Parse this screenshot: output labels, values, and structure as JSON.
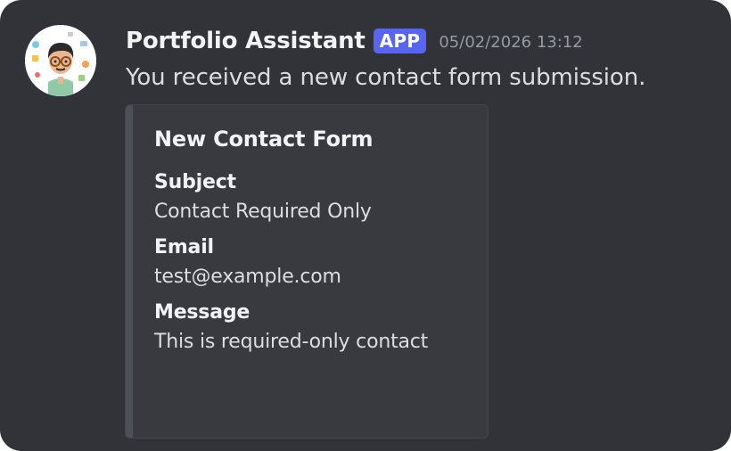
{
  "message": {
    "avatar_icon": "cartoon-developer-avatar-icon",
    "username": "Portfolio Assistant",
    "badge": "APP",
    "timestamp": "05/02/2026 13:12",
    "text": "You received a new contact form submission."
  },
  "embed": {
    "title": "New Contact Form",
    "fields": [
      {
        "name": "Subject",
        "value": "Contact Required Only"
      },
      {
        "name": "Email",
        "value": "test@example.com"
      },
      {
        "name": "Message",
        "value": "This is required-only contact"
      }
    ]
  },
  "colors": {
    "background": "#313338",
    "embed_background": "#383a40",
    "embed_bar": "#4e5058",
    "badge": "#5865f2",
    "text_primary": "#f2f3f5",
    "text_secondary": "#dbdee1",
    "timestamp": "#949ba4"
  }
}
